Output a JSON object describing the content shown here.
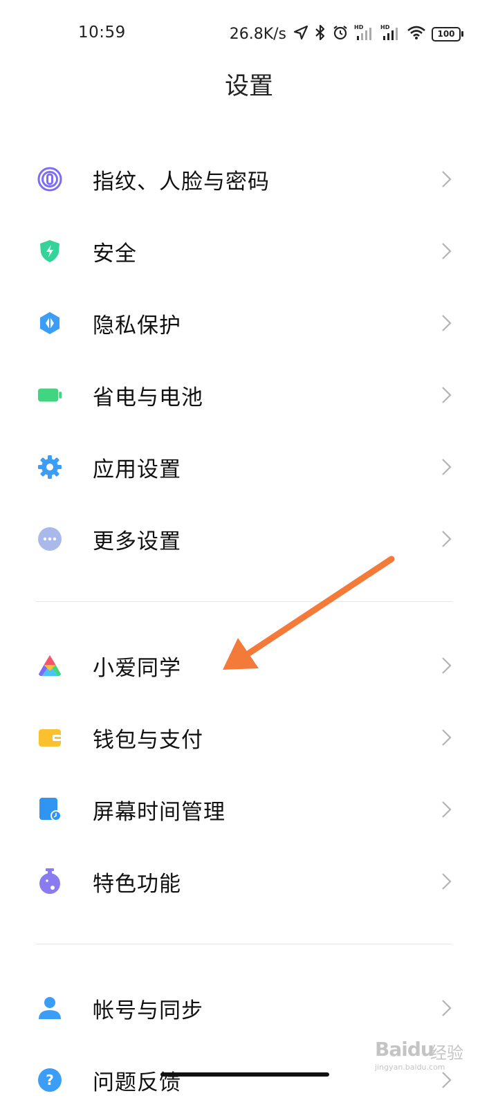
{
  "status_bar": {
    "time": "10:59",
    "net_speed": "26.8K/s",
    "battery": "100",
    "signal_label": "HD"
  },
  "header": {
    "title": "设置"
  },
  "groups": [
    {
      "items": [
        {
          "label": "指纹、人脸与密码",
          "icon": "fingerprint-icon",
          "color": "#7b6cf6"
        },
        {
          "label": "安全",
          "icon": "shield-icon",
          "color": "#34d399"
        },
        {
          "label": "隐私保护",
          "icon": "privacy-icon",
          "color": "#3b9df5"
        },
        {
          "label": "省电与电池",
          "icon": "battery-icon",
          "color": "#3fd67f"
        },
        {
          "label": "应用设置",
          "icon": "gear-icon",
          "color": "#3b9df5"
        },
        {
          "label": "更多设置",
          "icon": "more-icon",
          "color": "#a9b9ec"
        }
      ]
    },
    {
      "items": [
        {
          "label": "小爱同学",
          "icon": "xiaoai-icon",
          "color": "#f2566b"
        },
        {
          "label": "钱包与支付",
          "icon": "wallet-icon",
          "color": "#fbc02d"
        },
        {
          "label": "屏幕时间管理",
          "icon": "screen-time-icon",
          "color": "#2f95f0"
        },
        {
          "label": "特色功能",
          "icon": "features-icon",
          "color": "#8a7cf0"
        }
      ]
    },
    {
      "items": [
        {
          "label": "帐号与同步",
          "icon": "account-icon",
          "color": "#3b9df5"
        },
        {
          "label": "问题反馈",
          "icon": "help-icon",
          "color": "#3b9df5"
        }
      ]
    }
  ],
  "annotation": {
    "arrow_color": "#f47a3a"
  },
  "watermark": {
    "brand": "Baidu",
    "brand_cn": "经验",
    "url": "jingyan.baidu.com"
  }
}
